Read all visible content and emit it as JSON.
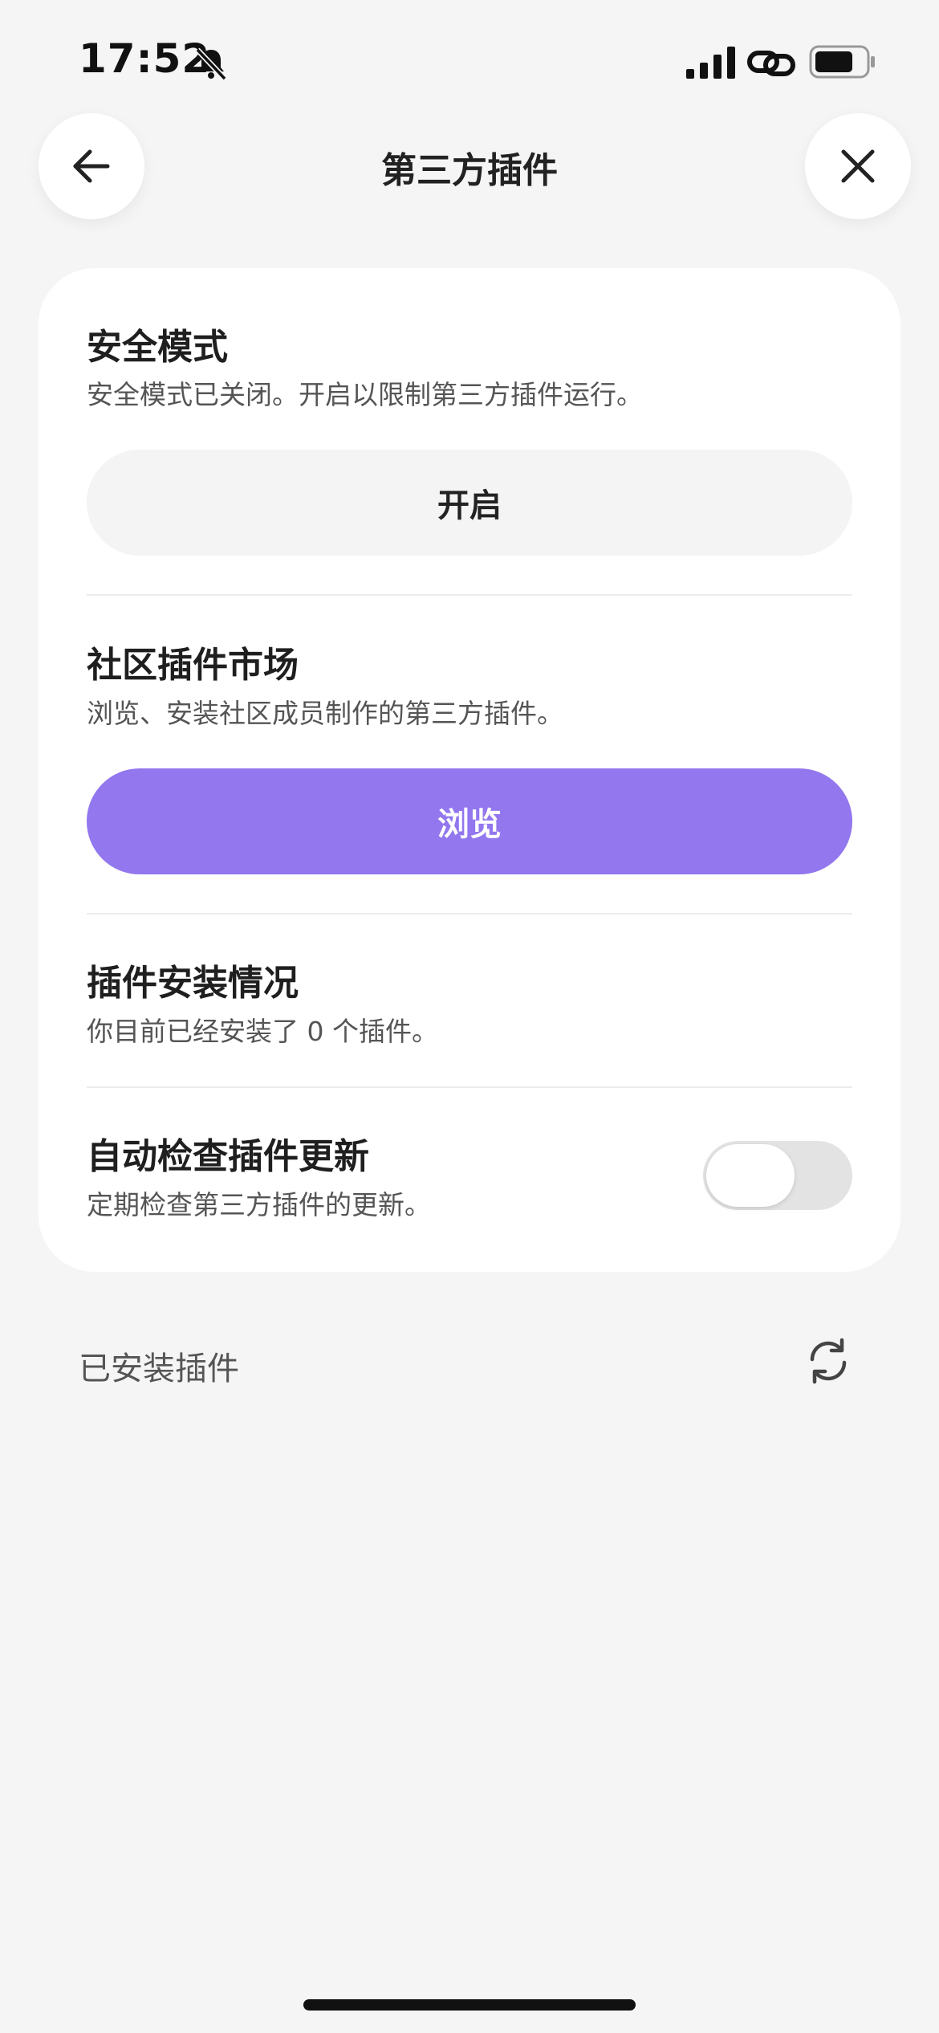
{
  "status_bar": {
    "time": "17:52",
    "icons": [
      "bell-off-icon",
      "signal-icon",
      "link-icon",
      "battery-icon"
    ]
  },
  "header": {
    "title": "第三方插件",
    "back_icon": "arrow-left-icon",
    "close_icon": "close-icon"
  },
  "sections": {
    "safe_mode": {
      "title": "安全模式",
      "description": "安全模式已关闭。开启以限制第三方插件运行。",
      "button_label": "开启"
    },
    "community": {
      "title": "社区插件市场",
      "description": "浏览、安装社区成员制作的第三方插件。",
      "button_label": "浏览"
    },
    "install_status": {
      "title": "插件安装情况",
      "description": "你目前已经安装了 0 个插件。"
    },
    "auto_update": {
      "title": "自动检查插件更新",
      "description": "定期检查第三方插件的更新。",
      "enabled": false
    }
  },
  "installed": {
    "label": "已安装插件",
    "refresh_icon": "refresh-icon"
  },
  "colors": {
    "accent": "#9277ee",
    "background": "#f5f5f5",
    "card": "#ffffff"
  }
}
